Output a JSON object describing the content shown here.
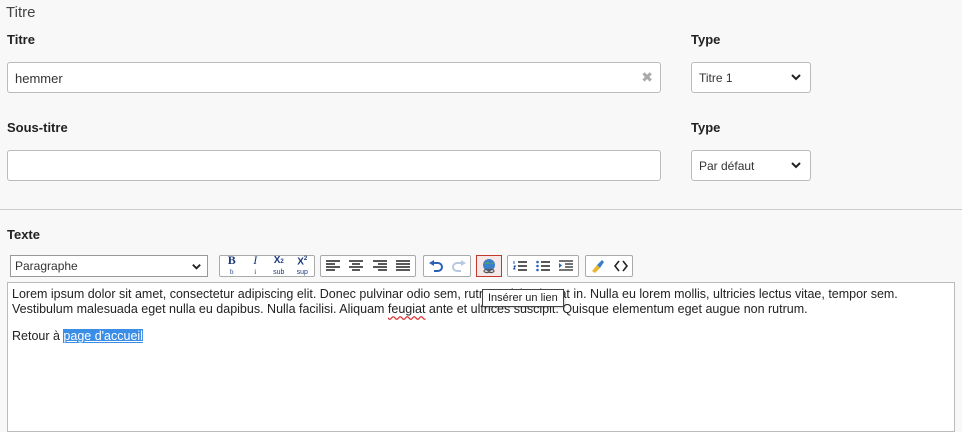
{
  "section": {
    "title": "Titre"
  },
  "title_field": {
    "label": "Titre",
    "value": "hemmer",
    "clear_glyph": "✖"
  },
  "title_type": {
    "label": "Type",
    "selected": "Titre 1"
  },
  "subtitle_field": {
    "label": "Sous-titre",
    "value": ""
  },
  "subtitle_type": {
    "label": "Type",
    "selected": "Par défaut"
  },
  "text": {
    "label": "Texte",
    "format_select": "Paragraphe",
    "tooltip": "Insérer un lien",
    "body": {
      "p1_parts": [
        "Lorem ipsum dolor sit amet, consectetur adipiscing elit. Donec pulvinar odio sem, ",
        "rutrum nisi volutpat in. Nulla eu lorem mollis, ultricies lectus vitae, tempor sem. Vestibulum malesuada eget nulla eu dapibus. Nulla facilisi. Aliquam ",
        "feugiat",
        " ante et ultrices suscipit. Quisque elementum eget augue non rutrum."
      ],
      "p2_prefix": "Retour à ",
      "p2_link": "page d'accueil"
    },
    "icons": {
      "bold": "B",
      "italic": "I",
      "sub": "X",
      "sup": "X",
      "sub_caption": "sub",
      "sup_caption": "sup",
      "bold_caption": "b",
      "italic_caption": "i"
    }
  },
  "colors": {
    "active_border": "#c0392b",
    "selection": "#3b8ee8",
    "toolbar_icon": "#1b3a7a"
  }
}
